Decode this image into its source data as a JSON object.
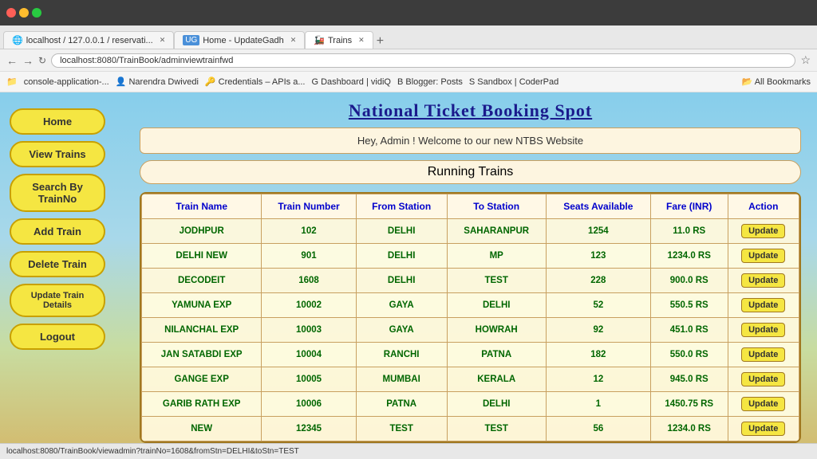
{
  "browser": {
    "url": "localhost:8080/TrainBook/adminviewtrainfwd",
    "tabs": [
      {
        "label": "localhost / 127.0.0.1 / reservati...",
        "active": false,
        "favicon": "🌐"
      },
      {
        "label": "Home - UpdateGadh",
        "active": false,
        "favicon": "UG"
      },
      {
        "label": "Trains",
        "active": true,
        "favicon": "🚂"
      }
    ],
    "bookmarks": [
      "console-application-...",
      "Narendra Dwivedi",
      "Credentials – APIs a...",
      "Dashboard | vidiQ",
      "Blogger: Posts",
      "Sandbox | CoderPad",
      "All Bookmarks"
    ]
  },
  "site": {
    "title": "National Ticket Booking Spot",
    "welcome_message": "Hey, Admin ! Welcome to our new NTBS Website",
    "running_trains_label": "Running Trains"
  },
  "sidebar": {
    "buttons": [
      {
        "label": "Home",
        "name": "home-button"
      },
      {
        "label": "View Trains",
        "name": "view-trains-button"
      },
      {
        "label": "Search By TrainNo",
        "name": "search-by-trainno-button"
      },
      {
        "label": "Add Train",
        "name": "add-train-button"
      },
      {
        "label": "Delete Train",
        "name": "delete-train-button"
      },
      {
        "label": "Update Train Details",
        "name": "update-train-details-button"
      },
      {
        "label": "Logout",
        "name": "logout-button"
      }
    ]
  },
  "table": {
    "headers": [
      "Train Name",
      "Train Number",
      "From Station",
      "To Station",
      "Seats Available",
      "Fare (INR)",
      "Action"
    ],
    "rows": [
      {
        "train_name": "JODHPUR",
        "train_number": "102",
        "from_station": "DELHI",
        "to_station": "SAHARANPUR",
        "seats_available": "1254",
        "fare": "11.0 RS",
        "action": "Update"
      },
      {
        "train_name": "DELHI NEW",
        "train_number": "901",
        "from_station": "DELHI",
        "to_station": "MP",
        "seats_available": "123",
        "fare": "1234.0 RS",
        "action": "Update"
      },
      {
        "train_name": "DECODEIT",
        "train_number": "1608",
        "from_station": "DELHI",
        "to_station": "TEST",
        "seats_available": "228",
        "fare": "900.0 RS",
        "action": "Update"
      },
      {
        "train_name": "YAMUNA EXP",
        "train_number": "10002",
        "from_station": "GAYA",
        "to_station": "DELHI",
        "seats_available": "52",
        "fare": "550.5 RS",
        "action": "Update"
      },
      {
        "train_name": "NILANCHAL EXP",
        "train_number": "10003",
        "from_station": "GAYA",
        "to_station": "HOWRAH",
        "seats_available": "92",
        "fare": "451.0 RS",
        "action": "Update"
      },
      {
        "train_name": "JAN SATABDI EXP",
        "train_number": "10004",
        "from_station": "RANCHI",
        "to_station": "PATNA",
        "seats_available": "182",
        "fare": "550.0 RS",
        "action": "Update"
      },
      {
        "train_name": "GANGE EXP",
        "train_number": "10005",
        "from_station": "MUMBAI",
        "to_station": "KERALA",
        "seats_available": "12",
        "fare": "945.0 RS",
        "action": "Update"
      },
      {
        "train_name": "GARIB RATH EXP",
        "train_number": "10006",
        "from_station": "PATNA",
        "to_station": "DELHI",
        "seats_available": "1",
        "fare": "1450.75 RS",
        "action": "Update"
      },
      {
        "train_name": "NEW",
        "train_number": "12345",
        "from_station": "TEST",
        "to_station": "TEST",
        "seats_available": "56",
        "fare": "1234.0 RS",
        "action": "Update"
      }
    ]
  },
  "status_bar": {
    "url": "localhost:8080/TrainBook/viewadmin?trainNo=1608&fromStn=DELHI&toStn=TEST"
  }
}
